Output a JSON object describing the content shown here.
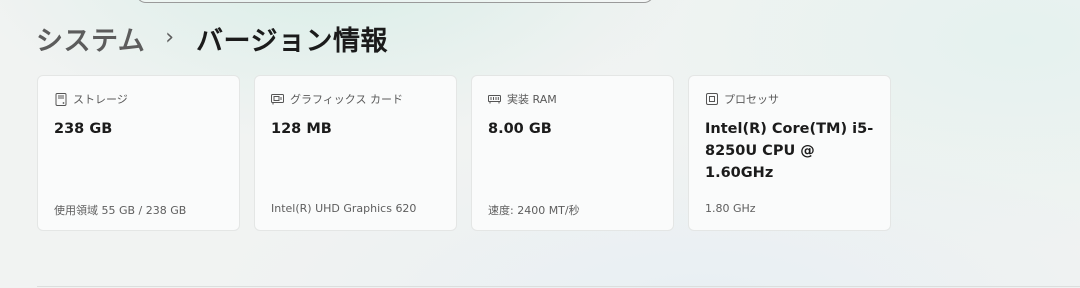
{
  "breadcrumb": {
    "parent": "システム",
    "separator": "›",
    "current": "バージョン情報"
  },
  "cards": [
    {
      "icon": "storage-icon",
      "title": "ストレージ",
      "value": "238 GB",
      "detail": "使用領域 55 GB / 238 GB"
    },
    {
      "icon": "graphics-card-icon",
      "title": "グラフィックス カード",
      "value": "128 MB",
      "detail": "Intel(R) UHD Graphics 620"
    },
    {
      "icon": "memory-icon",
      "title": "実装 RAM",
      "value": "8.00 GB",
      "detail": "速度: 2400 MT/秒"
    },
    {
      "icon": "processor-icon",
      "title": "プロセッサ",
      "value": "Intel(R) Core(TM) i5-8250U CPU @ 1.60GHz",
      "detail": "1.80 GHz"
    }
  ]
}
